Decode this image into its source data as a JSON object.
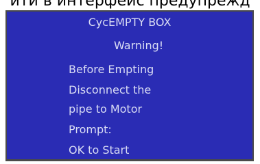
{
  "caption": "ити в интерфейс предупрежд",
  "screen": {
    "title": "CycEMPTY BOX",
    "warning": "Warning!",
    "lines": [
      "Before Empting",
      "Disconnect the",
      "pipe to Motor",
      "Prompt:",
      "OK to Start"
    ],
    "colors": {
      "background": "#2a2cb4",
      "text": "#d9dcf4",
      "border": "#4a4a4a"
    }
  }
}
